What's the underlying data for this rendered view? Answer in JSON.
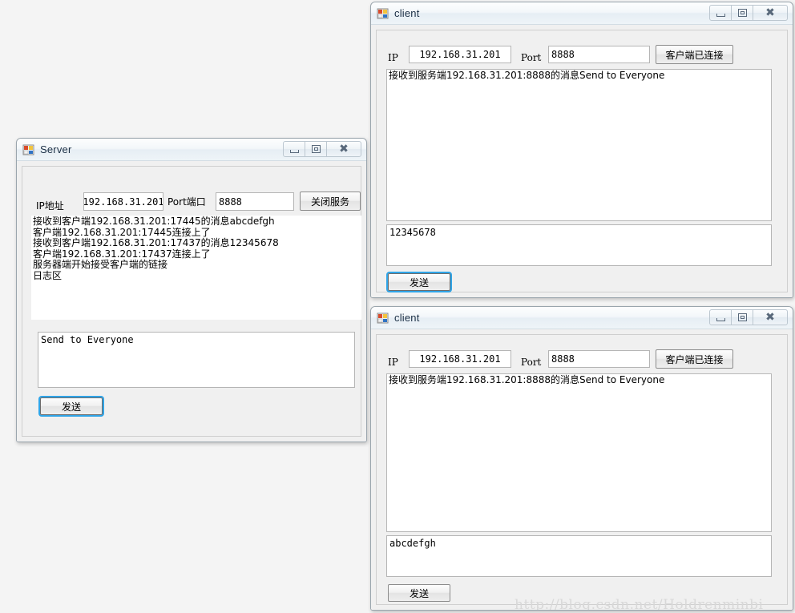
{
  "desktop": {
    "background": "#f4f4f4",
    "watermark": "http://blog.csdn.net/Holdrenminbi"
  },
  "window_controls": {
    "minimize": "minimize-icon",
    "maximize": "restore-icon",
    "close": "close-icon",
    "close_glyph": "✖"
  },
  "server_window": {
    "title": "Server",
    "icon": "winforms-icon",
    "ip_label": "IP地址",
    "ip_value": "192.168.31.201",
    "port_label": "Port端口",
    "port_value": "8888",
    "action_button": "关闭服务",
    "log_lines": [
      "接收到客户端192.168.31.201:17445的消息abcdefgh",
      "客户端192.168.31.201:17445连接上了",
      "接收到客户端192.168.31.201:17437的消息12345678",
      "客户端192.168.31.201:17437连接上了",
      "服务器端开始接受客户端的链接",
      "日志区"
    ],
    "message_value": "Send to Everyone",
    "send_button": "发送",
    "send_button_focused": true
  },
  "client_window_1": {
    "title": "client",
    "icon": "winforms-icon",
    "ip_label": "IP",
    "ip_value": "192.168.31.201",
    "port_label": "Port",
    "port_value": "8888",
    "action_button": "客户端已连接",
    "log_lines": [
      "接收到服务端192.168.31.201:8888的消息Send to Everyone"
    ],
    "message_value": "12345678",
    "send_button": "发送",
    "send_button_focused": true
  },
  "client_window_2": {
    "title": "client",
    "icon": "winforms-icon",
    "ip_label": "IP",
    "ip_value": "192.168.31.201",
    "port_label": "Port",
    "port_value": "8888",
    "action_button": "客户端已连接",
    "log_lines": [
      "接收到服务端192.168.31.201:8888的消息Send to Everyone"
    ],
    "message_value": "abcdefgh",
    "send_button": "发送",
    "send_button_focused": false
  }
}
